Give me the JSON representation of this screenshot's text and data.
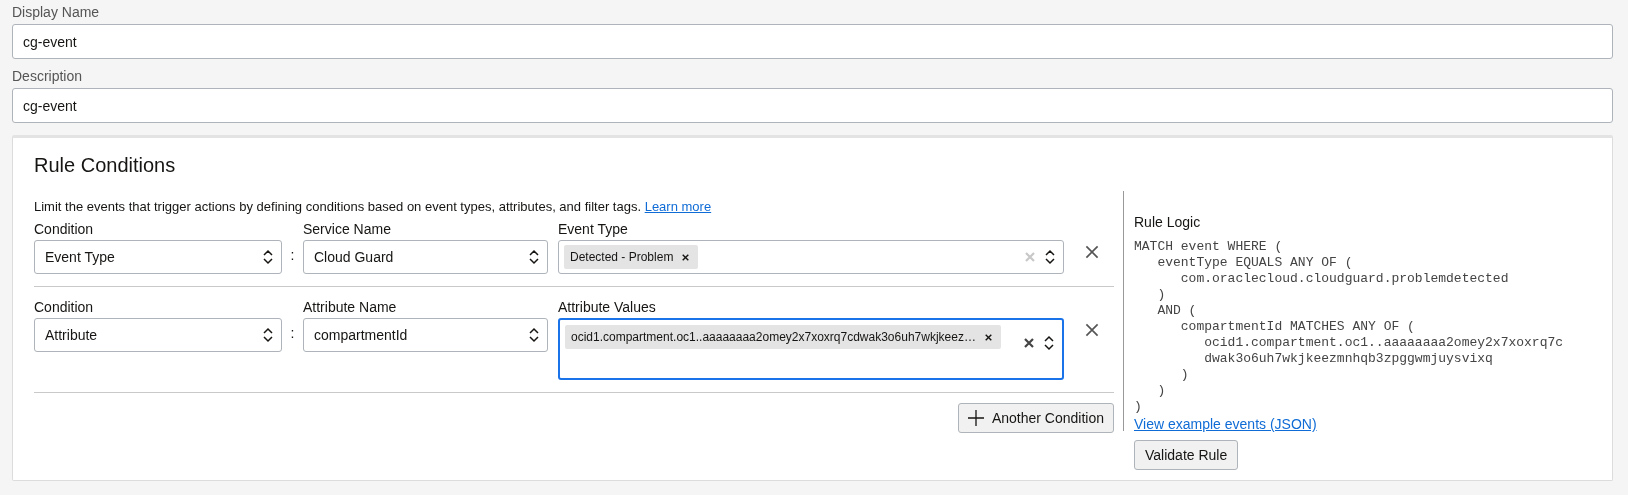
{
  "fields": [
    {
      "label": "Display Name",
      "value": "cg-event"
    },
    {
      "label": "Description",
      "value": "cg-event"
    }
  ],
  "rule_conditions": {
    "title": "Rule Conditions",
    "intro": {
      "text": "Limit the events that trigger actions by defining conditions based on event types, attributes, and filter tags.",
      "link": "Learn more"
    },
    "conditions": [
      {
        "condition_label": "Condition",
        "condition_value": "Event Type",
        "separator": ":",
        "name_label": "Service Name",
        "name_value": "Cloud Guard",
        "values_label": "Event Type",
        "tags": [
          "Detected - Problem"
        ],
        "focused": false
      },
      {
        "condition_label": "Condition",
        "condition_value": "Attribute",
        "separator": ":",
        "name_label": "Attribute Name",
        "name_value": "compartmentId",
        "values_label": "Attribute Values",
        "tags": [
          "ocid1.compartment.oc1..aaaaaaaa2omey2x7xoxrq7cdwak3o6uh7wkjkeez…"
        ],
        "focused": true
      }
    ],
    "add_button": "Another Condition"
  },
  "rule_logic": {
    "title": "Rule Logic",
    "code": "MATCH event WHERE (\n   eventType EQUALS ANY OF (\n      com.oraclecloud.cloudguard.problemdetected\n   )\n   AND (\n      compartmentId MATCHES ANY OF (\n         ocid1.compartment.oc1..aaaaaaaa2omey2x7xoxrq7c\n         dwak3o6uh7wkjkeezmnhqb3zpggwmjuysvixq\n      )\n   )\n)",
    "link": "View example events (JSON)",
    "button": "Validate Rule"
  }
}
